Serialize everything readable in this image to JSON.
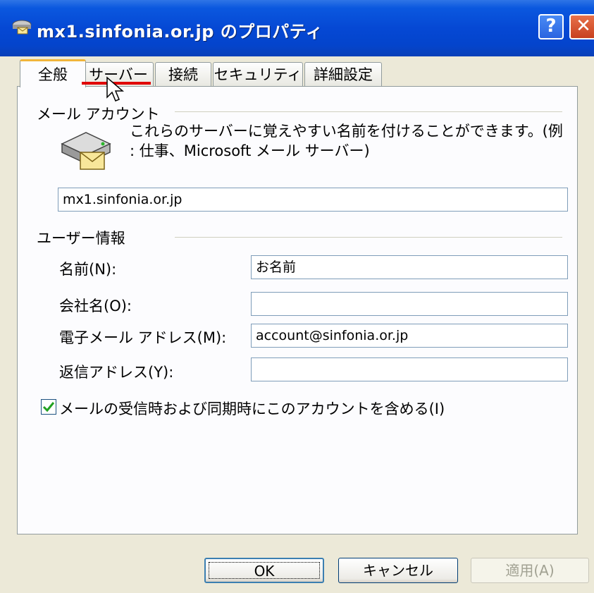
{
  "window": {
    "title": "mx1.sinfonia.or.jp のプロパティ",
    "help_label": "?",
    "close_label": "✕"
  },
  "tabs": [
    {
      "label": "全般",
      "active": true
    },
    {
      "label": "サーバー",
      "active": false
    },
    {
      "label": "接続",
      "active": false
    },
    {
      "label": "セキュリティ",
      "active": false
    },
    {
      "label": "詳細設定",
      "active": false
    }
  ],
  "mail_account": {
    "section_label": "メール アカウント",
    "description": "これらのサーバーに覚えやすい名前を付けることができます。(例 : 仕事、Microsoft メール サーバー)",
    "account_name": "mx1.sinfonia.or.jp"
  },
  "user_info": {
    "section_label": "ユーザー情報",
    "fields": [
      {
        "label": "名前(N):",
        "value": "お名前"
      },
      {
        "label": "会社名(O):",
        "value": ""
      },
      {
        "label": "電子メール アドレス(M):",
        "value": "account@sinfonia.or.jp"
      },
      {
        "label": "返信アドレス(Y):",
        "value": ""
      }
    ]
  },
  "include_account": {
    "label": "メールの受信時および同期時にこのアカウントを含める(I)",
    "checked": true
  },
  "buttons": {
    "ok": "OK",
    "cancel": "キャンセル",
    "apply": "適用(A)"
  },
  "colors": {
    "titlebar": "#0548d4",
    "active_tab_accent": "#f1b53a",
    "annotation_underline": "#e00000",
    "checkmark": "#21a121"
  }
}
